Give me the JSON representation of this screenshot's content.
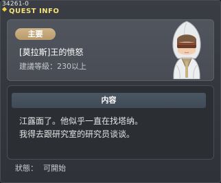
{
  "window": {
    "id_label": "34261-0",
    "title": "QUEST INFO"
  },
  "quest": {
    "badge": "主要",
    "name": "[莫拉斯]王的愤怒",
    "level_label": "建議等級：230以上"
  },
  "content": {
    "header": "内容",
    "lines": [
      "江露面了。他似乎一直在找塔纳。",
      "我得去跟研究室的研究员谈谈。"
    ]
  },
  "status": {
    "label": "狀態：",
    "value": "可開始"
  },
  "colors": {
    "title": "#f4e27a",
    "badge": "#c4a87a",
    "content_header": "#45505d"
  },
  "icons": {
    "portrait": "hooded-npc-portrait"
  }
}
